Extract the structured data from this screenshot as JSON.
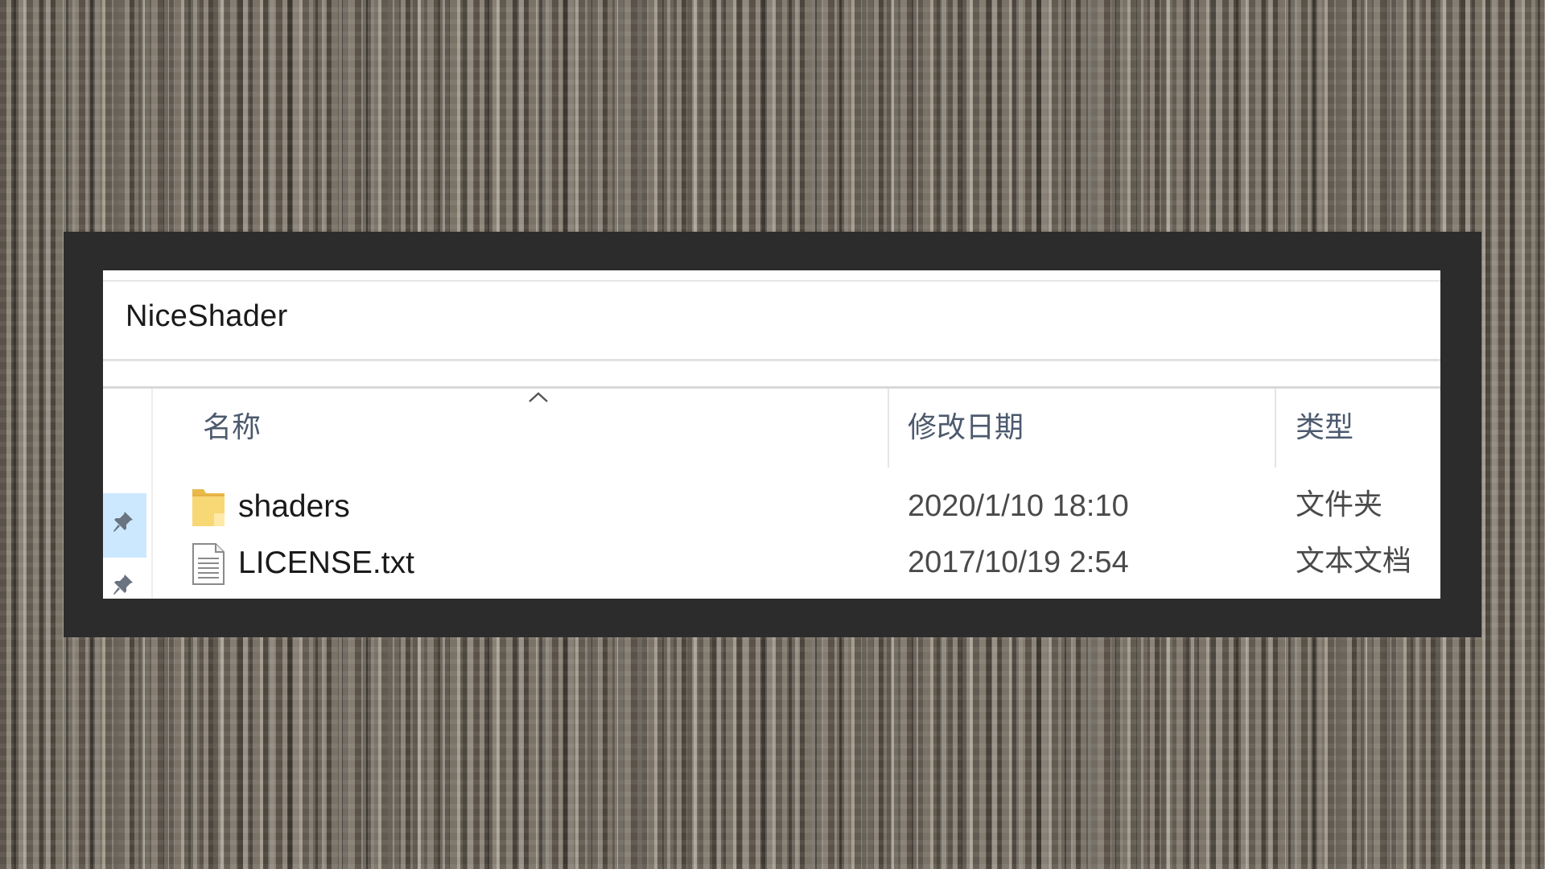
{
  "window": {
    "title": "NiceShader"
  },
  "columns": {
    "name": "名称",
    "modified": "修改日期",
    "type": "类型"
  },
  "files": [
    {
      "name": "shaders",
      "modified": "2020/1/10 18:10",
      "type": "文件夹",
      "icon": "folder-icon"
    },
    {
      "name": "LICENSE.txt",
      "modified": "2017/10/19 2:54",
      "type": "文本文档",
      "icon": "text-file-icon"
    }
  ],
  "colors": {
    "frame": "#2c2c2c",
    "window_bg": "#ffffff",
    "header_text": "#4c5a6e",
    "selection": "#cce8ff",
    "folder_yellow": "#f8d775"
  }
}
